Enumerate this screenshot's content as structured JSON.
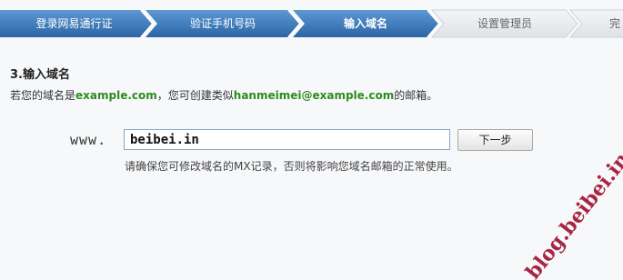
{
  "steps": [
    {
      "label": "登录网易通行证",
      "state": "done"
    },
    {
      "label": "验证手机号码",
      "state": "done"
    },
    {
      "label": "输入域名",
      "state": "active"
    },
    {
      "label": "设置管理员",
      "state": "pending"
    },
    {
      "label": "完",
      "state": "pending"
    }
  ],
  "colors": {
    "step_blue": "#3a78b8",
    "step_pending": "#e7eaee",
    "accent_green": "#2e8b20",
    "watermark": "#a01030"
  },
  "section": {
    "title": "3.输入域名",
    "intro_prefix": "若您的域名是",
    "intro_domain": "example.com",
    "intro_middle": "，您可创建类似",
    "intro_email": "hanmeimei@example.com",
    "intro_suffix": "的邮箱。"
  },
  "form": {
    "www_label": "www.",
    "domain_value": "beibei.in",
    "next_label": "下一步",
    "hint": "请确保您可修改域名的MX记录，否则将影响您域名邮箱的正常使用。"
  },
  "watermark": "blog.beibei.in"
}
